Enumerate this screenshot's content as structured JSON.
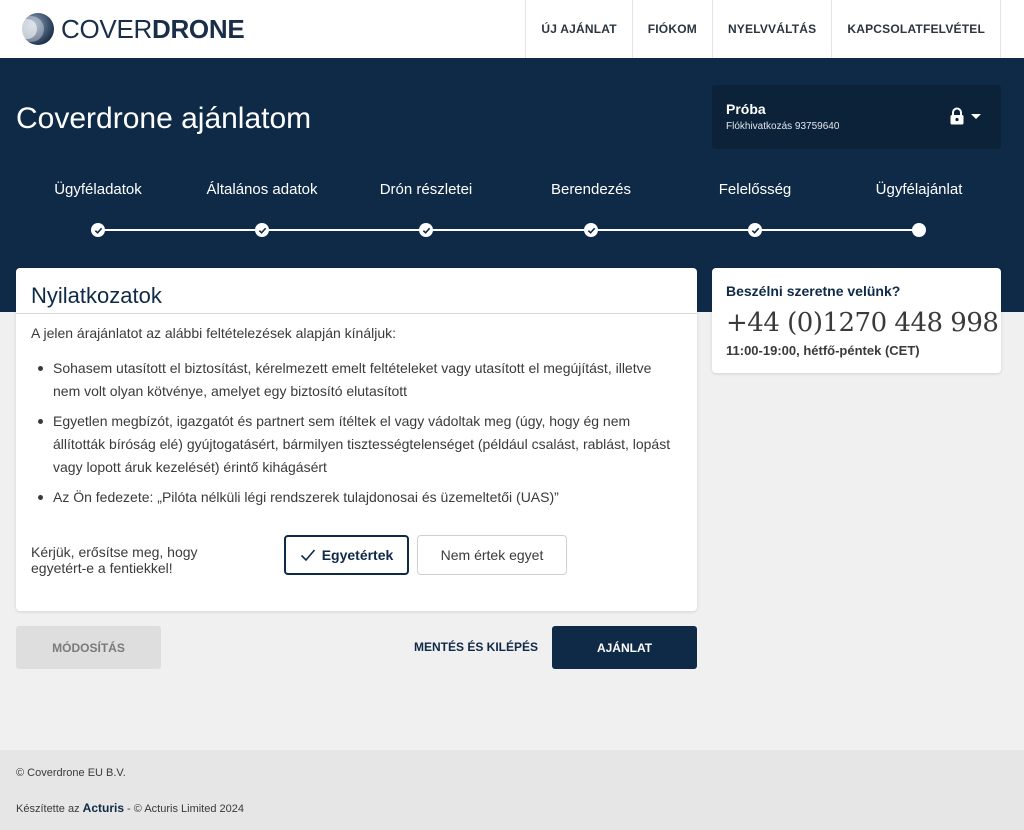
{
  "header": {
    "logo": {
      "part1": "COVER",
      "part2": "DRONE"
    },
    "nav": [
      "ÚJ AJÁNLAT",
      "FIÓKOM",
      "NYELVVÁLTÁS",
      "KAPCSOLATFELVÉTEL"
    ]
  },
  "hero": {
    "title": "Coverdrone ajánlatom",
    "account": {
      "name": "Próba",
      "sub": "Flókhivatkozás 93759640"
    },
    "steps": [
      {
        "label": "Ügyféladatok",
        "done": true
      },
      {
        "label": "Általános adatok",
        "done": true
      },
      {
        "label": "Drón részletei",
        "done": true
      },
      {
        "label": "Berendezés",
        "done": true
      },
      {
        "label": "Felelősség",
        "done": true
      },
      {
        "label": "Ügyfélajánlat",
        "done": false
      }
    ]
  },
  "declarations": {
    "title": "Nyilatkozatok",
    "intro": "A jelen árajánlatot az alábbi feltételezések alapján kínáljuk:",
    "items": [
      "Sohasem utasított el biztosítást, kérelmezett emelt feltételeket vagy utasított el megújítást, illetve nem volt olyan kötvénye, amelyet egy biztosító elutasított",
      "Egyetlen megbízót, igazgatót és partnert sem ítéltek el vagy vádoltak meg (úgy, hogy ég nem állították bíróság elé) gyújtogatásért, bármilyen tisztességtelenséget (például csalást, rablást, lopást vagy lopott áruk kezelését) érintő kihágásért",
      "Az Ön fedezete: „Pilóta nélküli légi rendszerek tulajdonosai és üzemeltetői (UAS)”"
    ],
    "confirm_question": "Kérjük, erősítse meg, hogy egyetért-e a fentiekkel!",
    "agree_label": "Egyetértek",
    "disagree_label": "Nem értek egyet"
  },
  "actions": {
    "modify_label": "MÓDOSÍTÁS",
    "save_exit_label": "MENTÉS ÉS KILÉPÉS",
    "quote_label": "AJÁNLAT"
  },
  "contact": {
    "title": "Beszélni szeretne velünk?",
    "phone": "+44 (0)1270 448 998",
    "hours": "11:00-19:00, hétfő-péntek (CET)"
  },
  "footer": {
    "copyright": "© Coverdrone EU B.V.",
    "made_by_prefix": "Készítette az ",
    "made_by_brand": "Acturis",
    "made_by_suffix": " - © Acturis Limited 2024"
  },
  "colors": {
    "primary": "#0f2a47",
    "background": "#f0f0f0",
    "footer": "#e6e6e6"
  }
}
